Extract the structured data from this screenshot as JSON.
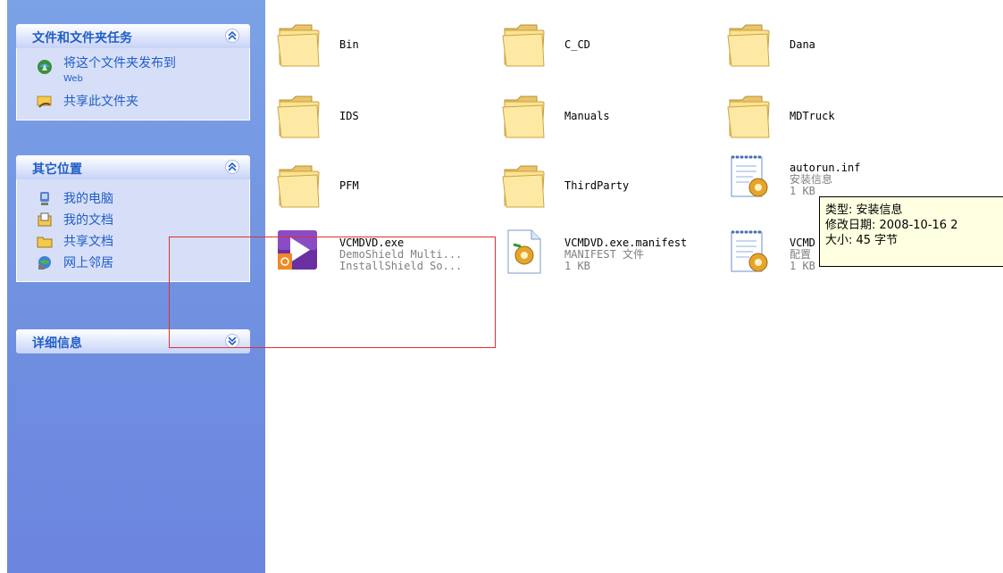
{
  "sidebar": {
    "tasks_panel": {
      "title": "文件和文件夹任务",
      "items": [
        {
          "label": "将这个文件夹发布到",
          "sublabel": "Web",
          "icon": "publish-web-icon"
        },
        {
          "label": "共享此文件夹",
          "icon": "share-folder-icon"
        }
      ]
    },
    "places_panel": {
      "title": "其它位置",
      "items": [
        {
          "label": "我的电脑",
          "icon": "my-computer-icon"
        },
        {
          "label": "我的文档",
          "icon": "my-documents-icon"
        },
        {
          "label": "共享文档",
          "icon": "shared-documents-icon"
        },
        {
          "label": "网上邻居",
          "icon": "network-places-icon"
        }
      ]
    },
    "details_panel": {
      "title": "详细信息"
    }
  },
  "files": [
    {
      "name": "Bin",
      "type": "folder"
    },
    {
      "name": "C_CD",
      "type": "folder"
    },
    {
      "name": "Dana",
      "type": "folder"
    },
    {
      "name": "IDS",
      "type": "folder"
    },
    {
      "name": "Manuals",
      "type": "folder"
    },
    {
      "name": "MDTruck",
      "type": "folder"
    },
    {
      "name": "PFM",
      "type": "folder"
    },
    {
      "name": "ThirdParty",
      "type": "folder"
    },
    {
      "name": "autorun.inf",
      "desc": "安装信息",
      "size": "1 KB",
      "type": "inf"
    },
    {
      "name": "VCMDVD.exe",
      "desc": "DemoShield Multi...",
      "size": "InstallShield So...",
      "type": "exe"
    },
    {
      "name": "VCMDVD.exe.manifest",
      "desc": "MANIFEST 文件",
      "size": "1 KB",
      "type": "manifest"
    },
    {
      "name": "VCMD",
      "desc": "配置",
      "size": "1 KB",
      "type": "config"
    }
  ],
  "tooltip": {
    "line1": "类型: 安装信息",
    "line2": "修改日期: 2008-10-16 2",
    "line3": "大小: 45 字节"
  },
  "colors": {
    "sidebar_bg": "#7ba2e7",
    "panel_title": "#215dc6",
    "tooltip_bg": "#ffffe1",
    "selection_border": "#e03030"
  }
}
